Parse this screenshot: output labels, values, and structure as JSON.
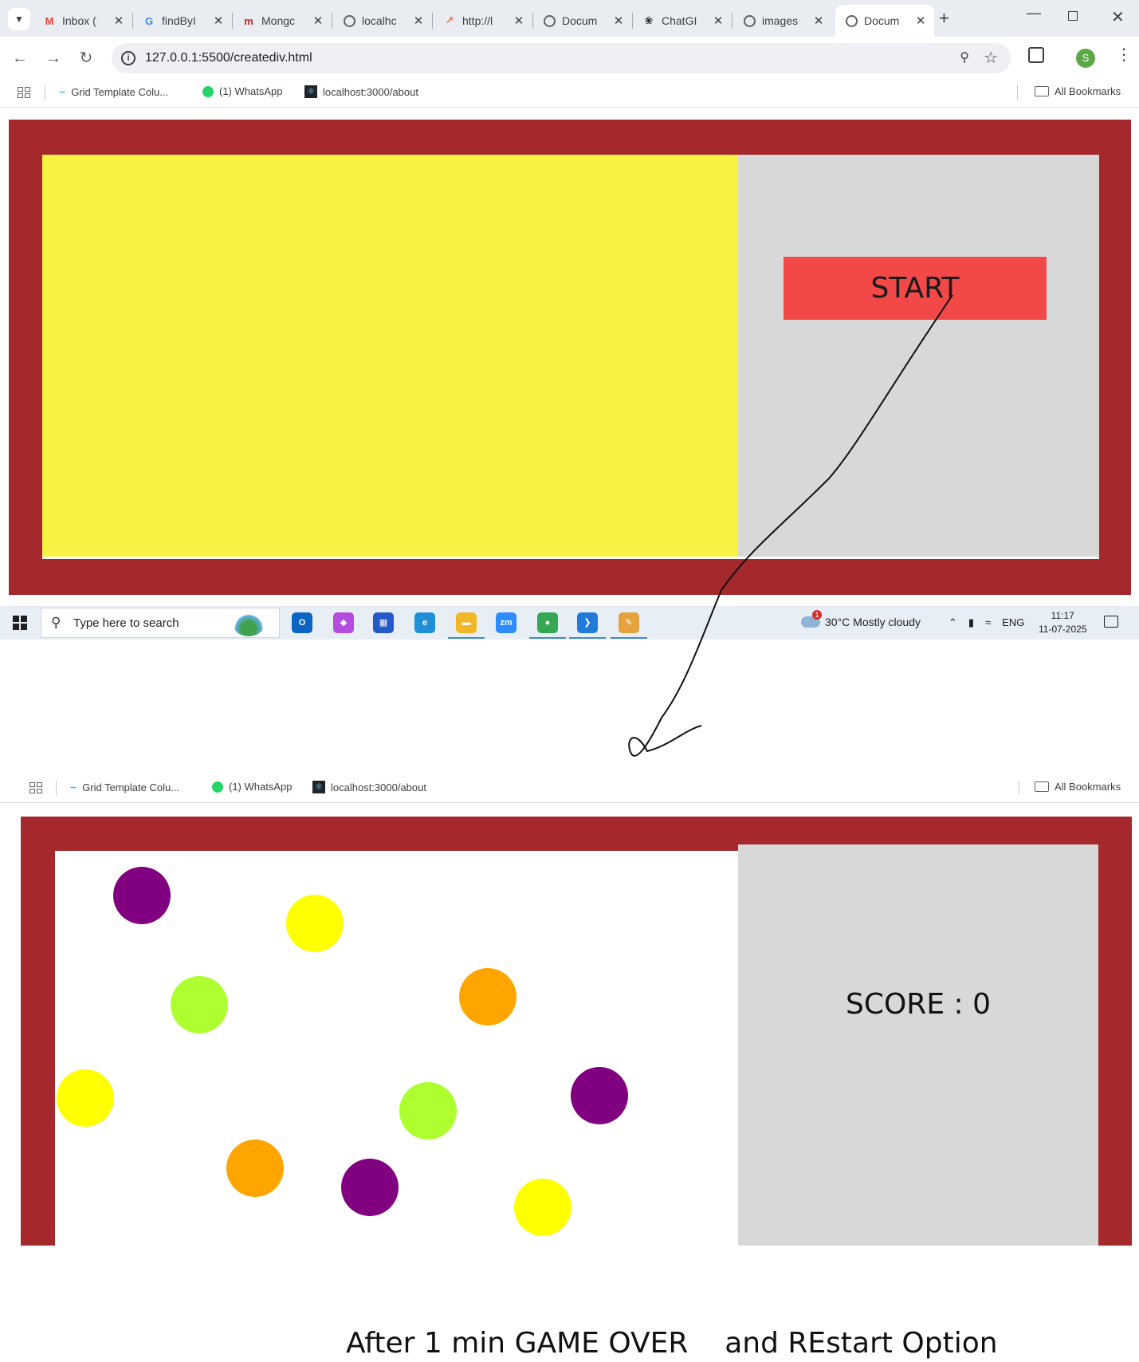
{
  "tabs": [
    {
      "title": "Inbox (",
      "icon": "gmail-icon",
      "fav_text": "M",
      "fav_color": "#ea4335"
    },
    {
      "title": "findByI",
      "icon": "google-icon",
      "fav_text": "G",
      "fav_color": "#4285f4"
    },
    {
      "title": "Mongc",
      "icon": "medium-icon",
      "fav_text": "m",
      "fav_color": "#c62828"
    },
    {
      "title": "localhc",
      "icon": "globe-icon"
    },
    {
      "title": "http://l",
      "icon": "postman-icon",
      "fav_text": "↗",
      "fav_color": "#ff6c37"
    },
    {
      "title": "Docum",
      "icon": "globe-icon"
    },
    {
      "title": "ChatGI",
      "icon": "chatgpt-icon",
      "fav_text": "❀",
      "fav_color": "#202124"
    },
    {
      "title": "images",
      "icon": "globe-icon"
    },
    {
      "title": "Docum",
      "icon": "globe-icon",
      "active": true
    }
  ],
  "address": {
    "url": "127.0.0.1:5500/creatediv.html"
  },
  "profile_initial": "S",
  "bookmarks": {
    "items": [
      {
        "label": "Grid Template Colu..."
      },
      {
        "label": "(1) WhatsApp"
      },
      {
        "label": "localhost:3000/about"
      }
    ],
    "all_label": "All Bookmarks"
  },
  "game_before": {
    "start_label": "START"
  },
  "taskbar": {
    "search_placeholder": "Type here to search",
    "weather": "30°C  Mostly cloudy",
    "lang": "ENG",
    "time": "11:17",
    "date": "11-07-2025",
    "apps": [
      "outlook-icon",
      "copilot-icon",
      "store-icon",
      "edge-icon",
      "file-explorer-icon",
      "zoom-icon",
      "chrome-icon",
      "vscode-icon",
      "paint-icon"
    ]
  },
  "game_after": {
    "score_text": "SCORE : 0",
    "bubble_colors": [
      "#800080",
      "#ffff00",
      "#adff2f",
      "#ffa500",
      "#ffff00",
      "#adff2f",
      "#800080",
      "#ffa500",
      "#800080",
      "#ffff00"
    ]
  },
  "caption": "After 1 min GAME OVER    and REstart Option",
  "colors": {
    "frame": "#a5282c",
    "play_area": "#f8f342",
    "panel": "#d9d8d8",
    "start_button": "#f24848"
  }
}
